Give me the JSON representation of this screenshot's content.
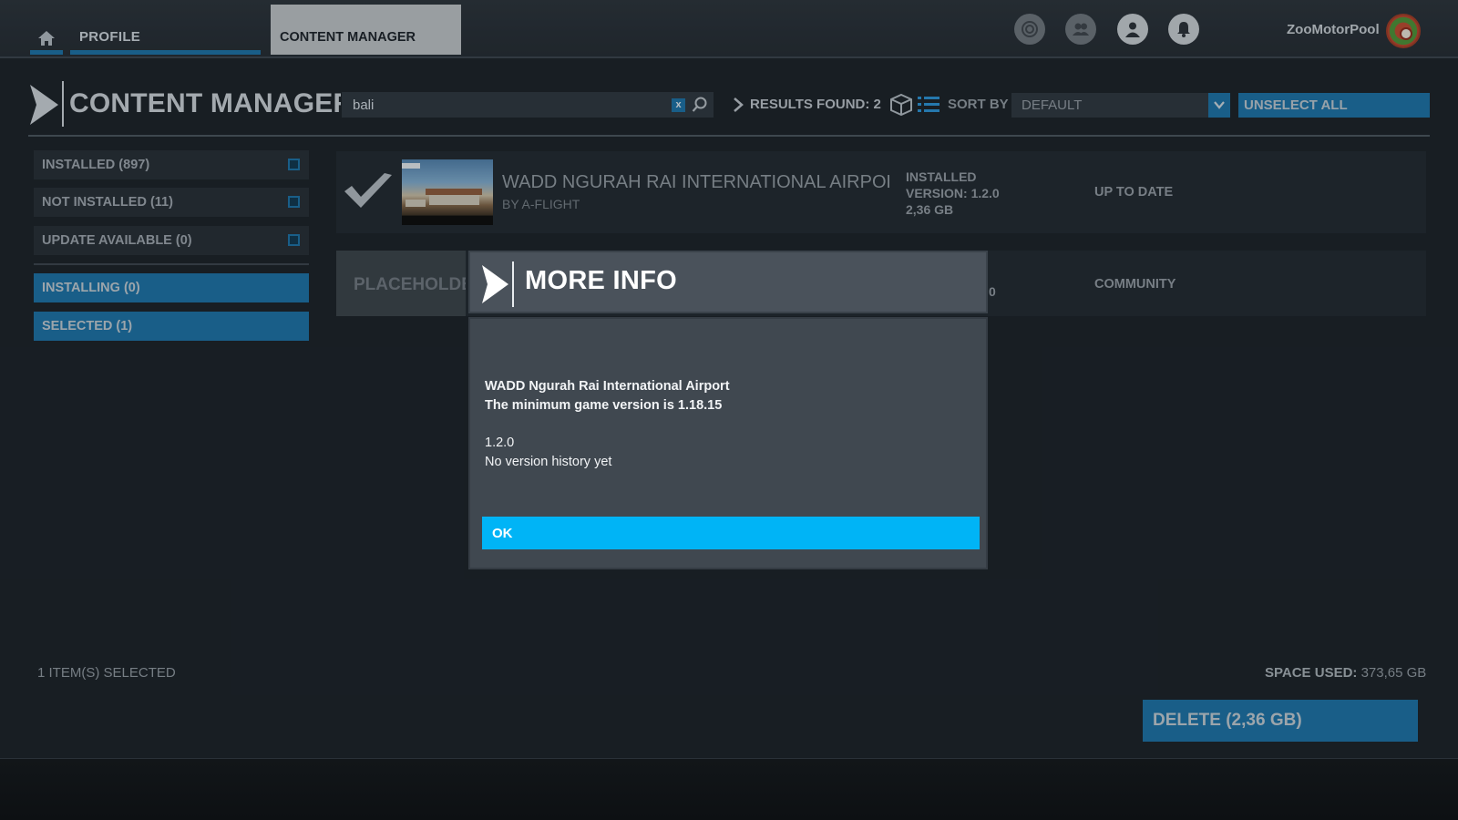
{
  "topnav": {
    "profile_tab": "PROFILE",
    "content_manager_tab": "CONTENT MANAGER",
    "icons": [
      "activity-icon",
      "friends-icon",
      "user-icon",
      "notifications-icon"
    ],
    "username": "ZooMotorPool"
  },
  "header": {
    "title": "CONTENT MANAGER",
    "search": {
      "value": "bali",
      "placeholder": "",
      "clear_label": "x"
    },
    "results_label": "RESULTS FOUND: 2",
    "sort_by_label": "SORT BY",
    "sort_value": "DEFAULT",
    "unselect_all": "UNSELECT ALL"
  },
  "sidebar": {
    "filters": [
      {
        "label": "INSTALLED (897)"
      },
      {
        "label": "NOT INSTALLED (11)"
      },
      {
        "label": "UPDATE AVAILABLE (0)"
      }
    ],
    "statuses": [
      {
        "label": "INSTALLING (0)"
      },
      {
        "label": "SELECTED (1)"
      }
    ]
  },
  "items": [
    {
      "title": "WADD NGURAH RAI INTERNATIONAL AIRPORT",
      "author": "BY A-FLIGHT",
      "status_lines": [
        "INSTALLED",
        "VERSION: 1.2.0",
        "2,36 GB"
      ],
      "state": "UP TO DATE"
    },
    {
      "thumbnail_label": "PLACEHOLDER",
      "extra": "0",
      "state": "COMMUNITY"
    }
  ],
  "footer": {
    "selected_count": "1 ITEM(S) SELECTED",
    "space_used_label": "SPACE USED:",
    "space_used_value": "373,65 GB",
    "delete_button": "DELETE (2,36 GB)"
  },
  "modal": {
    "title": "MORE INFO",
    "lines": [
      "WADD Ngurah Rai International Airport",
      "The minimum game version is 1.18.15",
      "1.2.0",
      "No version history yet"
    ],
    "ok_label": "OK"
  },
  "colors": {
    "accent_blue": "#1d6fa3",
    "ok_button": "#00b4f6",
    "background": "#1b2128"
  }
}
